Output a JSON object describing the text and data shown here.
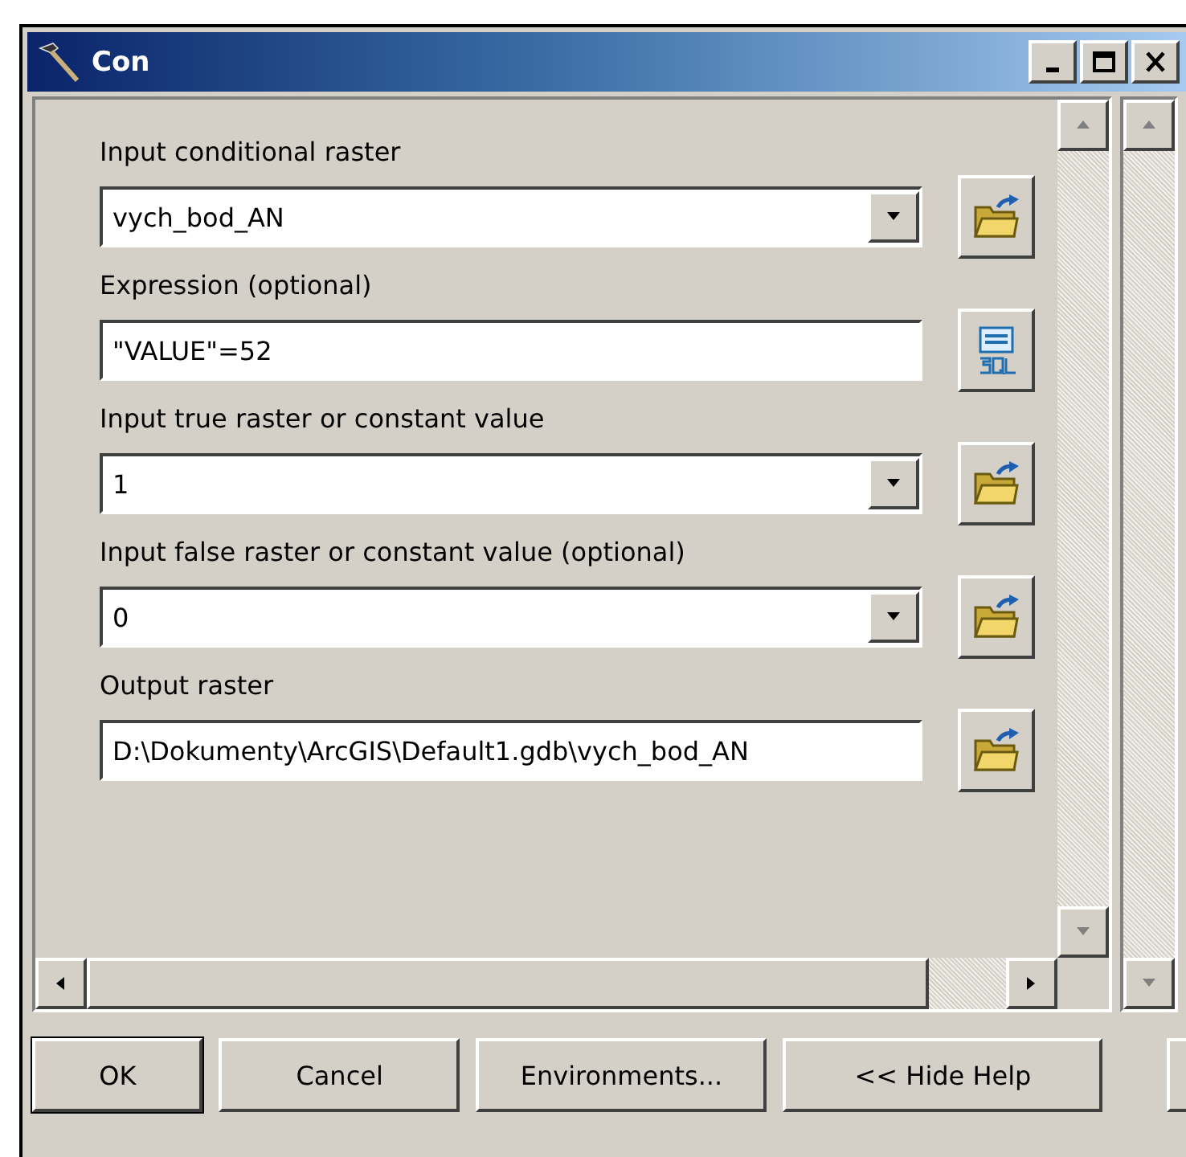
{
  "window": {
    "title": "Con"
  },
  "parameters": [
    {
      "label": "Input conditional raster",
      "kind": "dropdown",
      "value": "vych_bod_AN",
      "button": {
        "kind": "folder"
      }
    },
    {
      "label": "Expression (optional)",
      "kind": "text",
      "value": "\"VALUE\"=52",
      "button": {
        "kind": "sql"
      }
    },
    {
      "label": "Input true raster or constant value",
      "kind": "dropdown",
      "value": "1",
      "button": {
        "kind": "folder"
      }
    },
    {
      "label": "Input false raster or constant value (optional)",
      "kind": "dropdown",
      "value": "0",
      "button": {
        "kind": "folder"
      }
    },
    {
      "label": "Output raster",
      "kind": "text",
      "value": "D:\\Dokumenty\\ArcGIS\\Default1.gdb\\vych_bod_AN",
      "button": {
        "kind": "folder"
      }
    }
  ],
  "buttons": [
    {
      "label": "OK",
      "default": true
    },
    {
      "label": "Cancel",
      "default": false
    },
    {
      "label": "Environments...",
      "default": false
    },
    {
      "label": "<< Hide Help",
      "default": false
    }
  ]
}
